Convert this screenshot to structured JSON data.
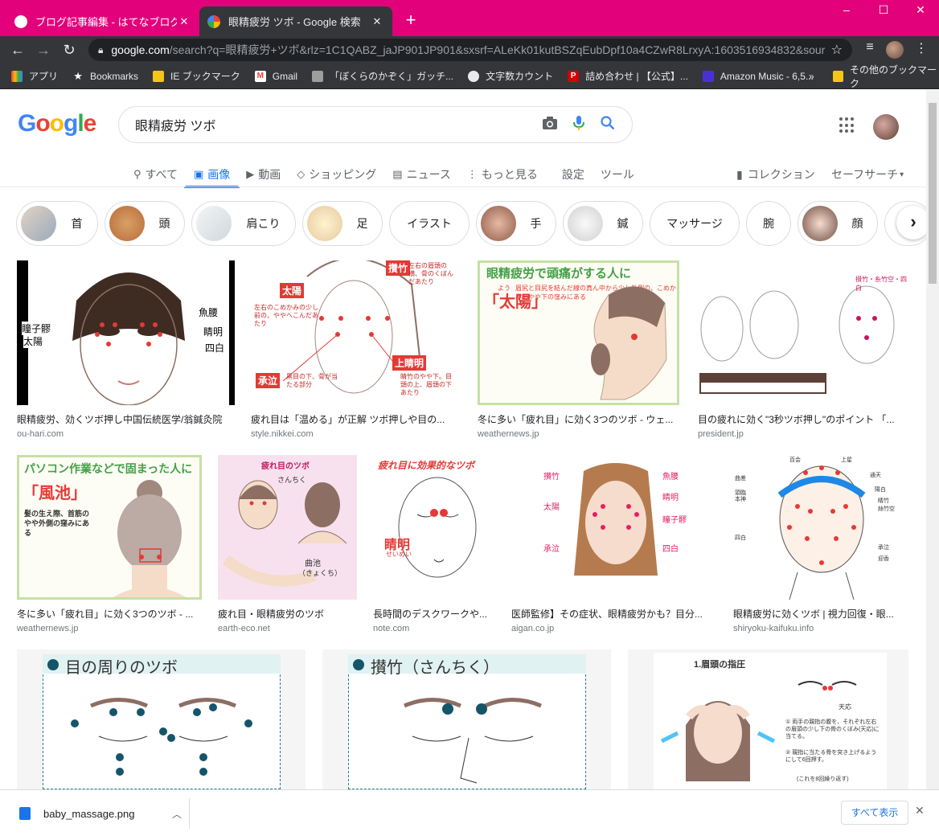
{
  "colors": {
    "titlebar": "#e2017b",
    "toolbar": "#35363a",
    "accent": "#1a73e8"
  },
  "browser": {
    "tabs": [
      {
        "title": "ブログ記事編集 - はてなブログ",
        "favicon": "hatena-icon",
        "active": false
      },
      {
        "title": "眼精疲労 ツボ - Google 検索",
        "favicon": "google-icon",
        "active": true
      }
    ],
    "new_tab": "+",
    "window_controls": {
      "minimize": "–",
      "maximize": "☐",
      "close": "✕"
    },
    "url_host": "google.com",
    "url_path": "/search?q=眼精疲労+ツボ&rlz=1C1QABZ_jaJP901JP901&sxsrf=ALeKk01kutBSZqEubDpf10a4CZwR8LrxyA:1603516934832&sourc...",
    "bookmarks": [
      {
        "label": "アプリ",
        "icon": "apps-grid-icon"
      },
      {
        "label": "Bookmarks",
        "icon": "star-icon"
      },
      {
        "label": "IE ブックマーク",
        "icon": "folder-icon"
      },
      {
        "label": "Gmail",
        "icon": "gmail-icon"
      },
      {
        "label": "「ぼくらのかぞく」ガッチ...",
        "icon": "site-icon"
      },
      {
        "label": "文字数カウント",
        "icon": "globe-icon"
      },
      {
        "label": "詰め合わせ | 【公式】...",
        "icon": "p-icon"
      },
      {
        "label": "Amazon Music - 6,5...",
        "icon": "amazon-music-icon"
      }
    ],
    "bookmarks_more": "»",
    "other_bookmarks": "その他のブックマーク"
  },
  "google": {
    "logo": "Google",
    "query": "眼精疲労 ツボ",
    "nav_tabs": [
      {
        "label": "すべて",
        "icon": "search-icon",
        "active": false
      },
      {
        "label": "画像",
        "icon": "image-icon",
        "active": true
      },
      {
        "label": "動画",
        "icon": "video-icon",
        "active": false
      },
      {
        "label": "ショッピング",
        "icon": "tag-icon",
        "active": false
      },
      {
        "label": "ニュース",
        "icon": "news-icon",
        "active": false
      },
      {
        "label": "もっと見る",
        "icon": "more-vert-icon",
        "active": false
      },
      {
        "label": "設定",
        "icon": "",
        "active": false
      },
      {
        "label": "ツール",
        "icon": "",
        "active": false
      }
    ],
    "collection": "コレクション",
    "safesearch": "セーフサーチ",
    "chips": [
      "首",
      "頭",
      "肩こり",
      "足",
      "イラスト",
      "手",
      "鍼",
      "マッサージ",
      "腕",
      "顔"
    ],
    "results": [
      {
        "caption": "眼精疲労、効くツボ押し中国伝統医学/翁鍼灸院",
        "source": "ou-hari.com",
        "labels": [
          "瞳子髎",
          "太陽",
          "魚腰",
          "睛明",
          "四白"
        ]
      },
      {
        "caption": "疲れ目は「温める」が正解 ツボ押しや目の...",
        "source": "style.nikkei.com",
        "labels": [
          "太陽",
          "攢竹",
          "承泣",
          "上睛明",
          "左右のこめかみの少し前の、ややへこんだあたり",
          "左右の眉頭の横、骨のくぼんだあたり",
          "黒目の下、骨が当たる部分",
          "睛竹のやや下。目頭の上、眉頭の下あたり"
        ]
      },
      {
        "caption": "冬に多い「疲れ目」に効く3つのツボ - ウェ...",
        "source": "weathernews.jp",
        "labels": [
          "眼精疲労で頭痛がする人に",
          "「太陽」",
          "たい",
          "よう",
          "眉尻と目尻を結んだ線の真ん中から少し外側の、こめかみのやや下の窪みにある"
        ]
      },
      {
        "caption": "目の疲れに効く\"3秒ツボ押し\"のポイント 「...",
        "source": "president.jp",
        "labels": [
          "攅竹・糸竹空・四白"
        ]
      },
      {
        "caption": "冬に多い「疲れ目」に効く3つのツボ - ...",
        "source": "weathernews.jp",
        "labels": [
          "パソコン作業などで固まった人に",
          "「風池」",
          "髪の生え際、首筋のやや外側の窪みにある"
        ]
      },
      {
        "caption": "疲れ目・眼精疲労のツボ",
        "source": "earth-eco.net",
        "labels": [
          "疲れ目のツボ",
          "さんちく",
          "曲池",
          "（きょくち）"
        ]
      },
      {
        "caption": "長時間のデスクワークや...",
        "source": "note.com",
        "labels": [
          "疲れ目に効果的なツボ",
          "睛明",
          "せいめい"
        ]
      },
      {
        "caption": "医師監修】その症状、眼精疲労かも？目分...",
        "source": "aigan.co.jp",
        "labels": [
          "攅竹",
          "魚腰",
          "太陽",
          "睛明",
          "瞳子髎",
          "承泣",
          "四白"
        ]
      },
      {
        "caption": "眼精疲労に効くツボ | 視力回復・眼...",
        "source": "shiryoku-kaifuku.info",
        "labels": [
          "百会",
          "上星",
          "曲差",
          "通天",
          "頭臨",
          "本神",
          "陽白",
          "睛竹",
          "絲竹空",
          "承泣",
          "四白",
          "迎香"
        ]
      },
      {
        "caption": "",
        "source": "",
        "labels": [
          "目の周りのツボ"
        ]
      },
      {
        "caption": "",
        "source": "",
        "labels": [
          "攅竹（さんちく）"
        ]
      },
      {
        "caption": "",
        "source": "",
        "labels": [
          "1.眉頭の指圧",
          "天応",
          "① 両手の親指の腹を、それぞれ左右の眉頭の少し下の骨のくぼみ(天応)に当てる。",
          "② 親指に当たる骨を突き上げるようにして6回押す。",
          "(これを8回繰り返す)"
        ]
      }
    ]
  },
  "download": {
    "filename": "baby_massage.png",
    "show_all": "すべて表示"
  }
}
